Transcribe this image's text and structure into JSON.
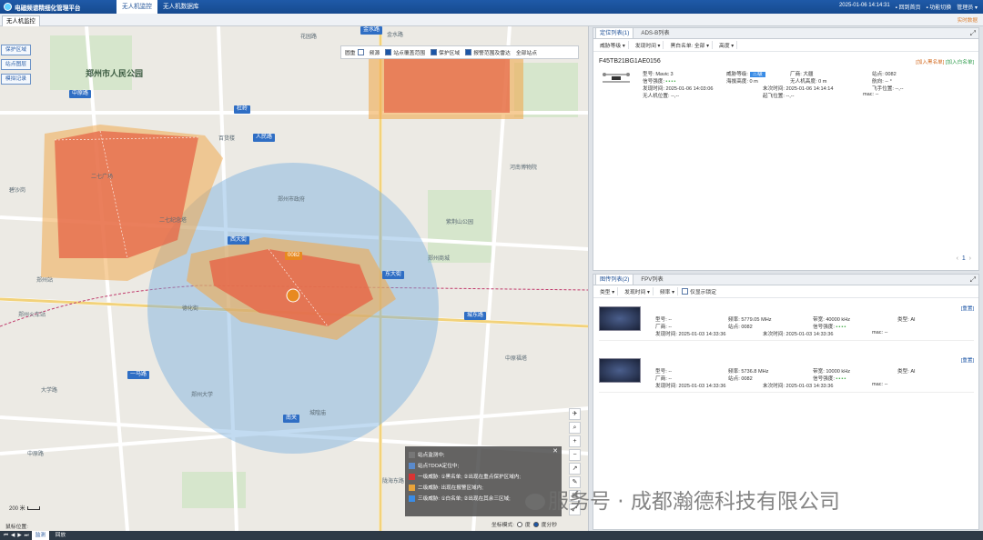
{
  "app": {
    "title": "电磁频谱精细化管理平台",
    "tabs": [
      {
        "label": "无人机监控",
        "active": true
      },
      {
        "label": "无人机数据库",
        "active": false
      }
    ],
    "datetime": "2025-01-06 14:14:31",
    "links": [
      "回到首页",
      "功能切换",
      "管理员"
    ]
  },
  "subtab": "无人机监控",
  "sublink": "实时数据",
  "leftButtons": [
    "保护区域",
    "站点图层",
    "模拟记录"
  ],
  "layers": [
    {
      "label": "圆重",
      "checked": false
    },
    {
      "label": "频源",
      "checked": false
    },
    {
      "label": "站点覆盖范围",
      "checked": true
    },
    {
      "label": "保护区域",
      "checked": true
    },
    {
      "label": "报警范围及雷达",
      "checked": true
    },
    {
      "label": "全部站点",
      "checked": false
    }
  ],
  "map": {
    "labels": [
      "郑州市人民公园",
      "金水路",
      "花园路",
      "杜岭",
      "人民路",
      "西大街",
      "东大街",
      "郑州站",
      "郑州火车站",
      "二七纪念塔",
      "一马路",
      "城东路",
      "南关",
      "陇海东路",
      "中原路",
      "大学路",
      "航海路",
      "东里路",
      "郑州市政府",
      "二七广场",
      "紫荆山公园",
      "郑州大学",
      "德化街",
      "郑州商城",
      "城隍庙",
      "中原福塔",
      "百货楼",
      "碧沙岗",
      "河南博物院"
    ],
    "roadTags": [
      "杜岭",
      "人民路",
      "西大街",
      "东大街",
      "城东路",
      "南关",
      "金水路",
      "一马路",
      "中原路"
    ],
    "uavMarker": "0082"
  },
  "legend": {
    "items": [
      {
        "label": "站点监测中;",
        "color": "#4a4a4a"
      },
      {
        "label": "站点TDOA定位中;",
        "color": "#5a8acb"
      },
      {
        "label": "一级威胁: ①黑名单; ②出现在重点保护区域内;",
        "color": "#d93434"
      },
      {
        "label": "二级威胁: 出现在报警区域内;",
        "color": "#e8a33a"
      },
      {
        "label": "三级威胁: ①白名单; ②出现在其余三区域;",
        "color": "#3a8ce6"
      }
    ]
  },
  "coordMode": {
    "label": "坐标模式:",
    "options": [
      "度",
      "度分秒"
    ],
    "selected": "度分秒"
  },
  "scale": "200 米",
  "coordLabel": "鼠标位置:",
  "bottom": {
    "tabs": [
      "监测",
      "回放"
    ]
  },
  "locPanel": {
    "tabs": [
      "定位列表(1)",
      "ADS-B列表"
    ],
    "filters": [
      "威胁等级",
      "发现时间",
      "黑白名单: 全部",
      "高度"
    ],
    "uav": {
      "id": "F45TB21BG1AE0156",
      "actions": [
        "加入黑名单",
        "加入白名单"
      ],
      "model_l": "型号:",
      "model": "Mavic 3",
      "threat_l": "威胁等级:",
      "threat": "三级",
      "vendor_l": "厂商:",
      "vendor": "大疆",
      "station_l": "站点:",
      "station": "0082",
      "signal_l": "信号强度:",
      "alt_l": "海拔高度:",
      "alt": "0 m",
      "uavh_l": "无人机高度:",
      "uavh": "0 m",
      "heading_l": "航向:",
      "heading": "-- °",
      "found_l": "发现时间:",
      "found": "2025-01-06 14:03:06",
      "last_l": "末次时间:",
      "last": "2025-01-06 14:14:14",
      "pilot_l": "飞手位置:",
      "pilot": "--,--",
      "pos_l": "无人机位置:",
      "pos": "--,--",
      "takeoff_l": "起飞位置:",
      "takeoff": "--,--",
      "mac_l": "mac:",
      "mac": "--"
    },
    "page": "1"
  },
  "sigPanel": {
    "tabs": [
      "图传列表(2)",
      "FPV列表"
    ],
    "filters": [
      "类型",
      "发现时间",
      "频率"
    ],
    "onlyAnchor": "仅显示锁定",
    "reset": "[重置]",
    "items": [
      {
        "model_l": "型号:",
        "model": "--",
        "freq_l": "频率:",
        "freq": "5779.05 MHz",
        "bw_l": "带宽:",
        "bw": "40000 kHz",
        "type_l": "类型:",
        "type": "AI",
        "vendor_l": "厂商:",
        "vendor": "--",
        "station_l": "站点:",
        "station": "0082",
        "signal_l": "信号强度:",
        "found_l": "发现时间:",
        "found": "2025-01-03 14:33:36",
        "last_l": "末次时间:",
        "last": "2025-01-03 14:33:36",
        "mac_l": "mac:",
        "mac": "--"
      },
      {
        "model_l": "型号:",
        "model": "--",
        "freq_l": "频率:",
        "freq": "5736.8 MHz",
        "bw_l": "带宽:",
        "bw": "10000 kHz",
        "type_l": "类型:",
        "type": "AI",
        "vendor_l": "厂商:",
        "vendor": "--",
        "station_l": "站点:",
        "station": "0082",
        "signal_l": "信号强度:",
        "found_l": "发现时间:",
        "found": "2025-01-03 14:33:36",
        "last_l": "末次时间:",
        "last": "2025-01-03 14:33:36",
        "mac_l": "mac:",
        "mac": "--"
      }
    ]
  },
  "watermark": "服务号 · 成都瀚德科技有限公司"
}
